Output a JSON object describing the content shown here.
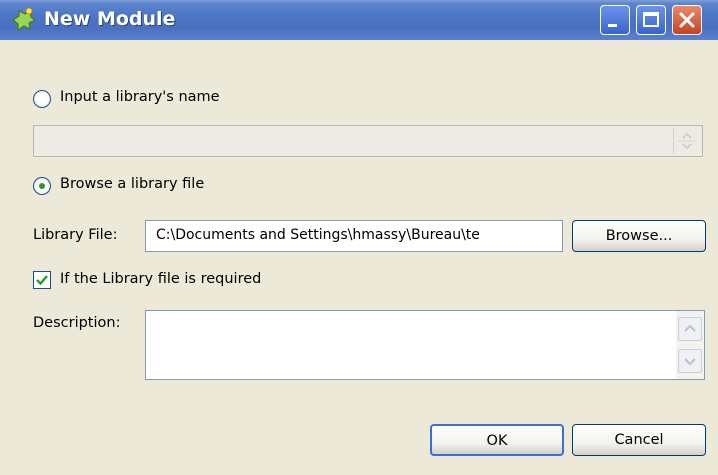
{
  "window": {
    "title": "New Module",
    "icon": "puzzle-icon",
    "controls": [
      "minimize-icon",
      "maximize-icon",
      "close-icon"
    ]
  },
  "form": {
    "radio_name_label": "Input a library's name",
    "radio_name_selected": false,
    "library_name_value": "",
    "radio_browse_label": "Browse a library file",
    "radio_browse_selected": true,
    "library_file_label": "Library File:",
    "library_file_value": "C:\\Documents and Settings\\hmassy\\Bureau\\te",
    "browse_button": "Browse...",
    "required_label": "If the Library file is required",
    "required_checked": true,
    "description_label": "Description:",
    "description_value": ""
  },
  "footer": {
    "ok_label": "OK",
    "cancel_label": "Cancel"
  }
}
